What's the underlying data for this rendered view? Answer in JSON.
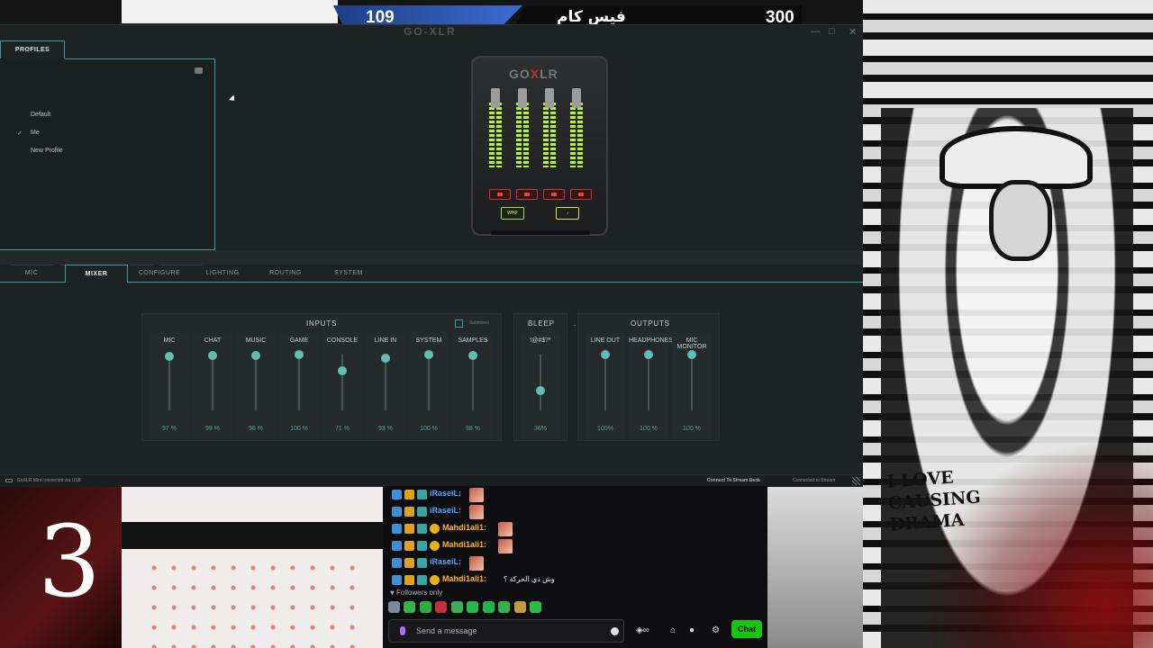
{
  "overlay": {
    "left_count": "109",
    "title": "فيس كام",
    "right_count": "300"
  },
  "app": {
    "logo": "GO-XLR",
    "window_controls": {
      "minimize": "—",
      "maximize": "□",
      "close": "✕"
    },
    "profiles": {
      "tab_label": "PROFILES",
      "items": [
        {
          "label": "Default",
          "selected": false
        },
        {
          "label": "Me",
          "selected": true
        },
        {
          "label": "New Profile",
          "selected": false
        }
      ],
      "actions": [
        {
          "icon": "save-icon",
          "glyph": "💾"
        },
        {
          "icon": "new-file-icon",
          "glyph": "🗋"
        },
        {
          "icon": "copy-icon",
          "glyph": "⧉"
        },
        {
          "icon": "trash-icon",
          "glyph": "🗑"
        }
      ]
    },
    "device": {
      "logo_a": "GO",
      "logo_x": "X",
      "logo_b": "LR",
      "fx_label": "WHP",
      "fx2_label": "♪"
    },
    "tabs": [
      "MIC",
      "MIXER",
      "CONFIGURE",
      "LIGHTING",
      "ROUTING",
      "SYSTEM"
    ],
    "active_tab": "MIXER",
    "mixer": {
      "inputs_title": "INPUTS",
      "submixes_label": "Submixes",
      "bleep_title": "BLEEP",
      "bleep_dot": ".",
      "outputs_title": "OUTPUTS",
      "inputs": [
        {
          "label": "MIC",
          "value": "97 %",
          "level": 0.97
        },
        {
          "label": "CHAT",
          "value": "99 %",
          "level": 0.99
        },
        {
          "label": "MUSIC",
          "value": "98 %",
          "level": 0.98
        },
        {
          "label": "GAME",
          "value": "100 %",
          "level": 1.0
        },
        {
          "label": "CONSOLE",
          "value": "71 %",
          "level": 0.71
        },
        {
          "label": "LINE IN",
          "value": "93 %",
          "level": 0.93
        },
        {
          "label": "SYSTEM",
          "value": "100 %",
          "level": 1.0
        },
        {
          "label": "SAMPLES",
          "value": "98 %",
          "level": 0.98
        }
      ],
      "bleep": {
        "label": "!@#$?*",
        "value": "36%",
        "level": 0.36
      },
      "outputs": [
        {
          "label": "LINE OUT",
          "value": "100%",
          "level": 1.0
        },
        {
          "label": "HEADPHONES",
          "value": "100 %",
          "level": 1.0
        },
        {
          "label": "MIC MONITOR",
          "value": "100 %",
          "level": 1.0
        }
      ]
    },
    "status": {
      "left": "GoXLR Mini connected via USB",
      "stream_deck": "Connect To Stream Deck",
      "stream": "Connected to Stream"
    }
  },
  "chat": {
    "rows": [
      {
        "user": "iRaseiL:",
        "color": "blue",
        "sub": false,
        "message": ""
      },
      {
        "user": "iRaseiL:",
        "color": "blue",
        "sub": false,
        "message": ""
      },
      {
        "user": "Mahdi1ali1:",
        "color": "gold",
        "sub": true,
        "message": ""
      },
      {
        "user": "Mahdi1ali1:",
        "color": "gold",
        "sub": true,
        "message": ""
      },
      {
        "user": "iRaseiL:",
        "color": "blue",
        "sub": false,
        "message": ""
      },
      {
        "user": "Mahdi1ali1:",
        "color": "gold",
        "sub": true,
        "message": "وش ذي الحركة ؟"
      }
    ],
    "followers_only": "Followers only",
    "input_placeholder": "Send a message",
    "chat_button": "Chat"
  },
  "stream_art": {
    "slogan_line1": "I LOVE",
    "slogan_line2": "CAUSING",
    "slogan_line3": "DRAMA",
    "big_number": "3"
  }
}
